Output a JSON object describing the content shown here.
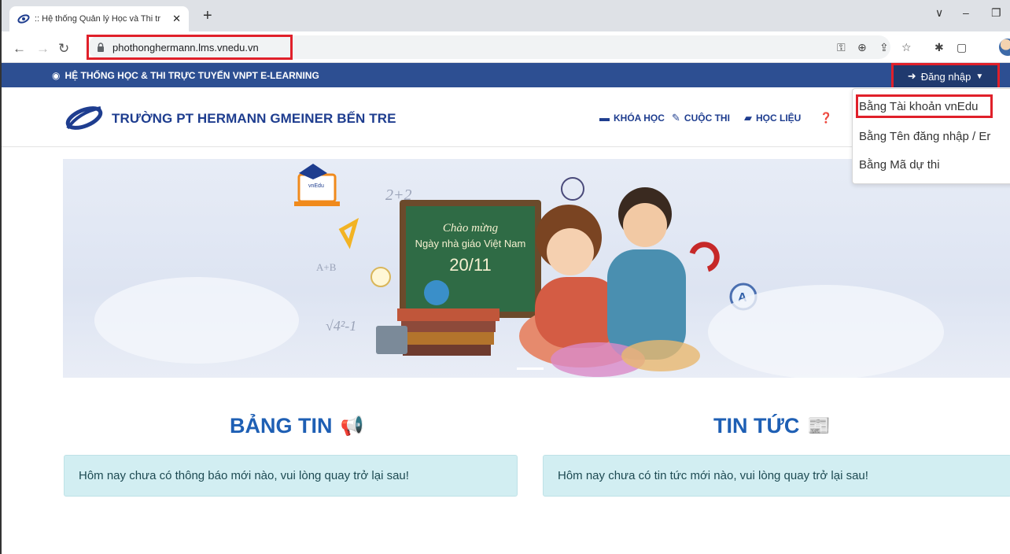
{
  "browser": {
    "tab_title": ":: Hệ thống Quản lý Học và Thi tr",
    "tab_close": "✕",
    "new_tab": "+",
    "url": "phothonghermann.lms.vnedu.vn",
    "window_controls": [
      "∨",
      "–",
      "❐"
    ]
  },
  "topbar": {
    "title": "HỆ THỐNG HỌC & THI TRỰC TUYẾN VNPT E-LEARNING",
    "login_label": "Đăng nhập"
  },
  "header": {
    "school_name": "TRƯỜNG PT HERMANN GMEINER BẾN TRE",
    "menu": [
      {
        "label": "KHÓA HỌC",
        "icon": "book-icon"
      },
      {
        "label": "CUỘC THI",
        "icon": "pencil-icon"
      },
      {
        "label": "HỌC LIỆU",
        "icon": "document-icon"
      },
      {
        "label": "",
        "icon": "question-icon"
      }
    ]
  },
  "login_dropdown": {
    "items": [
      "Bằng Tài khoản vnEdu",
      "Bằng Tên đăng nhập / Er",
      "Bằng Mã dự thi"
    ]
  },
  "banner": {
    "board_line1": "Chào mừng",
    "board_line2": "Ngày nhà giáo Việt Nam",
    "board_line3": "20/11",
    "doodle1": "2+2",
    "doodle2": "A+B",
    "doodle3": "√4²-1",
    "screen_label": "vnEdu"
  },
  "sections": {
    "board_title": "BẢNG TIN",
    "board_message": "Hôm nay chưa có thông báo mới nào, vui lòng quay trở lại sau!",
    "news_title": "TIN TỨC",
    "news_message": "Hôm nay chưa có tin tức mới nào, vui lòng quay trở lại sau!"
  },
  "colors": {
    "brand_blue": "#2d4f92",
    "heading_blue": "#1e5fb4",
    "highlight_red": "#e0202a",
    "notice_bg": "#d2eef2"
  }
}
